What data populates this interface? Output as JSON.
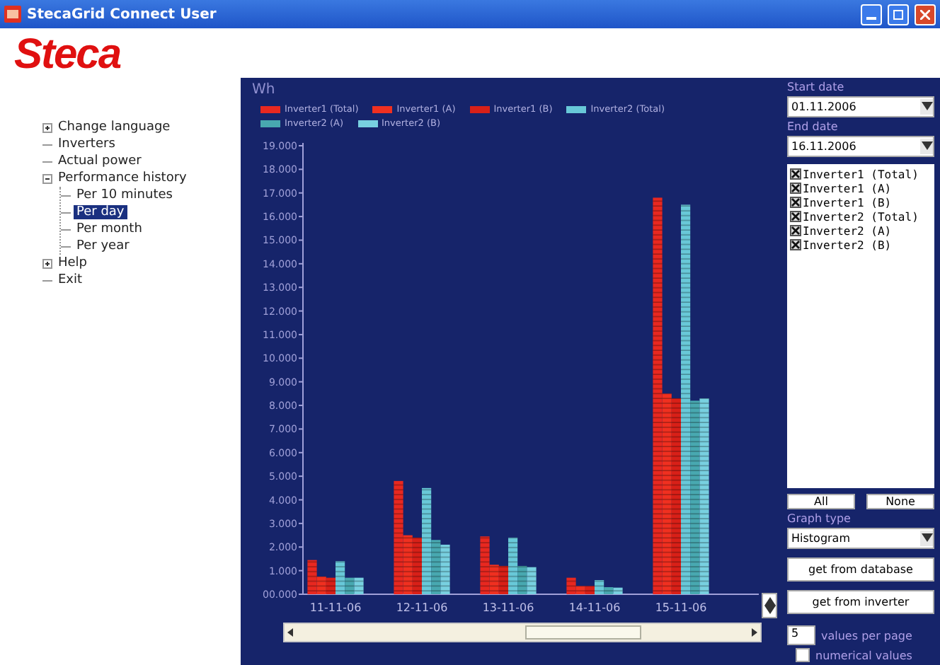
{
  "window": {
    "title": "StecaGrid Connect User",
    "logo": "Steca"
  },
  "tree": [
    {
      "label": "Change language",
      "expanded": false,
      "selected": false
    },
    {
      "label": "Inverters",
      "selected": false
    },
    {
      "label": "Actual power",
      "selected": false
    },
    {
      "label": "Performance history",
      "expanded": true,
      "selected": false,
      "children": [
        {
          "label": "Per 10 minutes",
          "selected": false
        },
        {
          "label": "Per day",
          "selected": true
        },
        {
          "label": "Per month",
          "selected": false
        },
        {
          "label": "Per year",
          "selected": false
        }
      ]
    },
    {
      "label": "Help",
      "expanded": false,
      "selected": false
    },
    {
      "label": "Exit",
      "selected": false
    }
  ],
  "chart": {
    "chart_data": {
      "type": "bar",
      "ylabel": "Wh",
      "categories": [
        "11-11-06",
        "12-11-06",
        "13-11-06",
        "14-11-06",
        "15-11-06"
      ],
      "series": [
        {
          "name": "Inverter1 (Total)",
          "color": "#e82820",
          "values": [
            1450,
            4800,
            2450,
            700,
            16800
          ]
        },
        {
          "name": "Inverter1 (A)",
          "color": "#f03020",
          "values": [
            750,
            2500,
            1250,
            350,
            8500
          ]
        },
        {
          "name": "Inverter1 (B)",
          "color": "#d82018",
          "values": [
            700,
            2400,
            1200,
            350,
            8300
          ]
        },
        {
          "name": "Inverter2 (Total)",
          "color": "#68c8d8",
          "values": [
            1400,
            4500,
            2400,
            600,
            16500
          ]
        },
        {
          "name": "Inverter2 (A)",
          "color": "#48a8b0",
          "values": [
            700,
            2300,
            1200,
            300,
            8200
          ]
        },
        {
          "name": "Inverter2 (B)",
          "color": "#78d0e0",
          "values": [
            700,
            2100,
            1150,
            280,
            8300
          ]
        }
      ],
      "ylim": [
        0,
        19000
      ],
      "yticks": [
        {
          "value": 0,
          "label": "00.000"
        },
        {
          "value": 1000,
          "label": "1.000"
        },
        {
          "value": 2000,
          "label": "2.000"
        },
        {
          "value": 3000,
          "label": "3.000"
        },
        {
          "value": 4000,
          "label": "4.000"
        },
        {
          "value": 5000,
          "label": "5.000"
        },
        {
          "value": 6000,
          "label": "6.000"
        },
        {
          "value": 7000,
          "label": "7.000"
        },
        {
          "value": 8000,
          "label": "8.000"
        },
        {
          "value": 9000,
          "label": "9.000"
        },
        {
          "value": 10000,
          "label": "10.000"
        },
        {
          "value": 11000,
          "label": "11.000"
        },
        {
          "value": 12000,
          "label": "12.000"
        },
        {
          "value": 13000,
          "label": "13.000"
        },
        {
          "value": 14000,
          "label": "14.000"
        },
        {
          "value": 15000,
          "label": "15.000"
        },
        {
          "value": 16000,
          "label": "16.000"
        },
        {
          "value": 17000,
          "label": "17.000"
        },
        {
          "value": 18000,
          "label": "18.000"
        },
        {
          "value": 19000,
          "label": "19.000"
        }
      ]
    }
  },
  "controls": {
    "start_label": "Start date",
    "start_value": "01.11.2006",
    "end_label": "End date",
    "end_value": "16.11.2006",
    "series_list": [
      {
        "label": "Inverter1 (Total)",
        "checked": true
      },
      {
        "label": "Inverter1 (A)",
        "checked": true
      },
      {
        "label": "Inverter1 (B)",
        "checked": true
      },
      {
        "label": "Inverter2 (Total)",
        "checked": true
      },
      {
        "label": "Inverter2 (A)",
        "checked": true
      },
      {
        "label": "Inverter2 (B)",
        "checked": true
      }
    ],
    "all_button": "All",
    "none_button": "None",
    "graph_type_label": "Graph type",
    "graph_type_value": "Histogram",
    "db_button": "get from database",
    "inverter_button": "get from inverter",
    "values_per_page": "5",
    "values_per_page_label": "values per page",
    "numerical_values": {
      "label": "numerical values",
      "checked": false
    }
  }
}
